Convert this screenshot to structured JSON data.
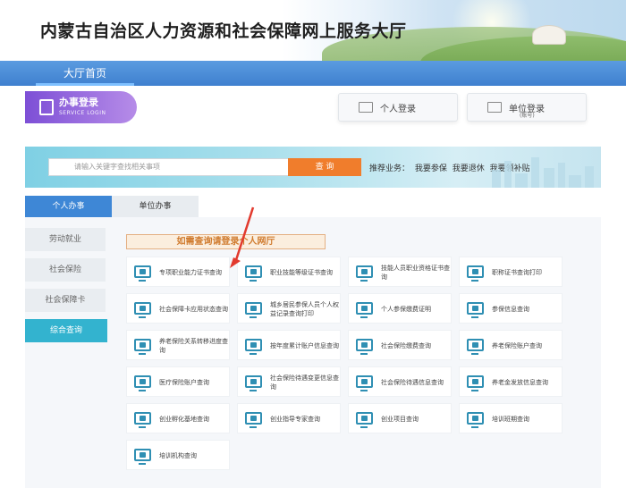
{
  "header": {
    "title": "内蒙古自治区人力资源和社会保障网上服务大厅"
  },
  "nav": {
    "home_tab": "大厅首页"
  },
  "login": {
    "service_title": "办事登录",
    "service_subtitle": "SERVICE LOGIN",
    "personal_label": "个人登录",
    "unit_label": "单位登录",
    "unit_sub": "(账号)"
  },
  "search": {
    "placeholder": "请输入关键字查找相关事项",
    "button_label": "查 询",
    "recommend_label": "推荐业务：",
    "recommend_items": [
      "我要参保",
      "我要退休",
      "我要领补贴"
    ]
  },
  "tabs": {
    "personal": "个人办事",
    "unit": "单位办事"
  },
  "sidebar": {
    "items": [
      {
        "label": "劳动就业"
      },
      {
        "label": "社会保险"
      },
      {
        "label": "社会保障卡"
      },
      {
        "label": "综合查询"
      }
    ]
  },
  "notice": "如需查询请登录个人网厅",
  "services": [
    {
      "label": "专项职业能力证书查询"
    },
    {
      "label": "职业技能等级证书查询"
    },
    {
      "label": "技能人员职业资格证书查询"
    },
    {
      "label": "职称证书查询打印"
    },
    {
      "label": "社会保障卡应用状态查询"
    },
    {
      "label": "城乡居民参保人员个人权益记录查询打印"
    },
    {
      "label": "个人参保缴费证明"
    },
    {
      "label": "参保信息查询"
    },
    {
      "label": "养老保险关系转移进度查询"
    },
    {
      "label": "按年度累计账户信息查询"
    },
    {
      "label": "社会保险缴费查询"
    },
    {
      "label": "养老保险账户查询"
    },
    {
      "label": "医疗保险账户查询"
    },
    {
      "label": "社会保险待遇变更信息查询"
    },
    {
      "label": "社会保险待遇信息查询"
    },
    {
      "label": "养老金发放信息查询"
    },
    {
      "label": "创业孵化基地查询"
    },
    {
      "label": "创业指导专家查询"
    },
    {
      "label": "创业项目查询"
    },
    {
      "label": "培训班期查询"
    },
    {
      "label": "培训机构查询"
    }
  ],
  "colors": {
    "nav_blue": "#3f80cf",
    "tab_active": "#3e87d6",
    "sidebar_active": "#33b3cf",
    "search_button": "#f07d2c",
    "notice_text": "#d07b2e",
    "login_purple": "#7d4fd6"
  }
}
